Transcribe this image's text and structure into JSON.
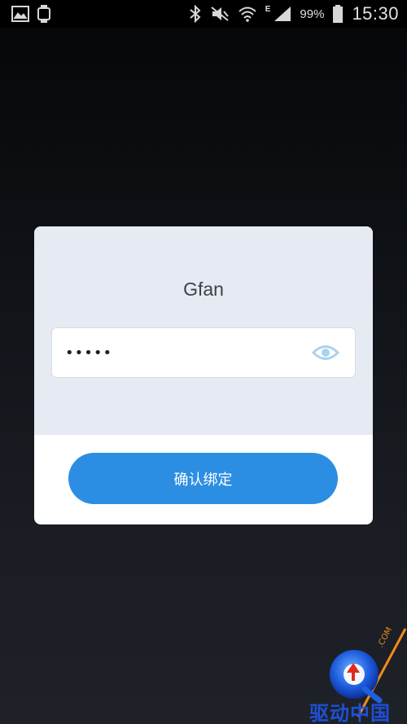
{
  "status_bar": {
    "battery_percent": "99%",
    "time": "15:30",
    "network_type": "E",
    "icons": [
      "gallery-icon",
      "watch-icon",
      "bluetooth-icon",
      "mute-icon",
      "wifi-icon",
      "signal-icon",
      "battery-icon"
    ]
  },
  "dialog": {
    "title": "Gfan",
    "password_field": {
      "value": "•••••",
      "toggle_icon": "eye-icon"
    },
    "confirm_label": "确认绑定"
  },
  "watermark": {
    "text": "驱动中国",
    "side_text": ".COM"
  },
  "colors": {
    "button": "#2c8ee2",
    "dialog_top": "#e5eaf3",
    "eye_icon": "#a9d2ef"
  }
}
